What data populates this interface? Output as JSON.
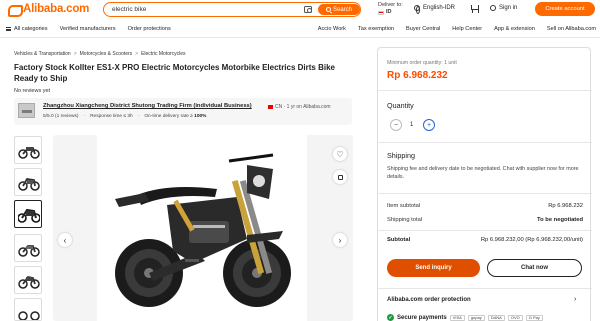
{
  "header": {
    "logo": "Alibaba.com",
    "search_value": "electric bike",
    "search_button": "Search",
    "deliver_to": "Deliver to:",
    "deliver_code": "ID",
    "language": "English-IDR",
    "sign_in": "Sign in",
    "create_account": "Create account"
  },
  "nav": {
    "left": [
      "All categories",
      "Verified manufacturers",
      "Order protections"
    ],
    "right": [
      "Accio Work",
      "Tax exemption",
      "Buyer Central",
      "Help Center",
      "App & extension",
      "Sell on Alibaba.com"
    ]
  },
  "breadcrumb": [
    "Vehicles & Transportation",
    "Motorcycles & Scooters",
    "Electric Motorcycles"
  ],
  "product": {
    "title": "Factory Stock Kollter ES1-X PRO Electric Motorcycles Motorbike Electrics Dirts Bike Ready to Ship",
    "reviews": "No reviews yet"
  },
  "supplier": {
    "name": "Zhangzhou Xiangcheng District Shutong Trading Firm (individual Business)",
    "meta": "CN · 1 yr on Alibaba.com",
    "rating": "5/5.0 (1 reviews)",
    "response": "Response time ≤ 3h",
    "delivery_label": "On-time delivery rate ≥",
    "delivery_rate": "100%"
  },
  "purchase": {
    "min_order": "Minimum order quantity: 1 unit",
    "price": "Rp 6.968.232",
    "quantity_label": "Quantity",
    "quantity_value": "1",
    "shipping_label": "Shipping",
    "shipping_text": "Shipping fee and delivery date to be negotiated. Chat with supplier now for more details.",
    "item_subtotal_label": "Item subtotal",
    "item_subtotal_value": "Rp 6.968.232",
    "shipping_total_label": "Shipping total",
    "shipping_total_value": "To be negotiated",
    "subtotal_label": "Subtotal",
    "subtotal_value": "Rp 6.968.232,00 (Rp 6.968.232,00/unit)",
    "send_inquiry": "Send inquiry",
    "chat_now": "Chat now",
    "protection": "Alibaba.com order protection",
    "secure_payments": "Secure payments",
    "payment_methods": [
      "VISA",
      "gopay",
      "DANA",
      "OVO",
      "G Pay"
    ]
  },
  "colors": {
    "brand": "#ff6a00",
    "price": "#ff4b00",
    "inquiry": "#e04e00"
  }
}
